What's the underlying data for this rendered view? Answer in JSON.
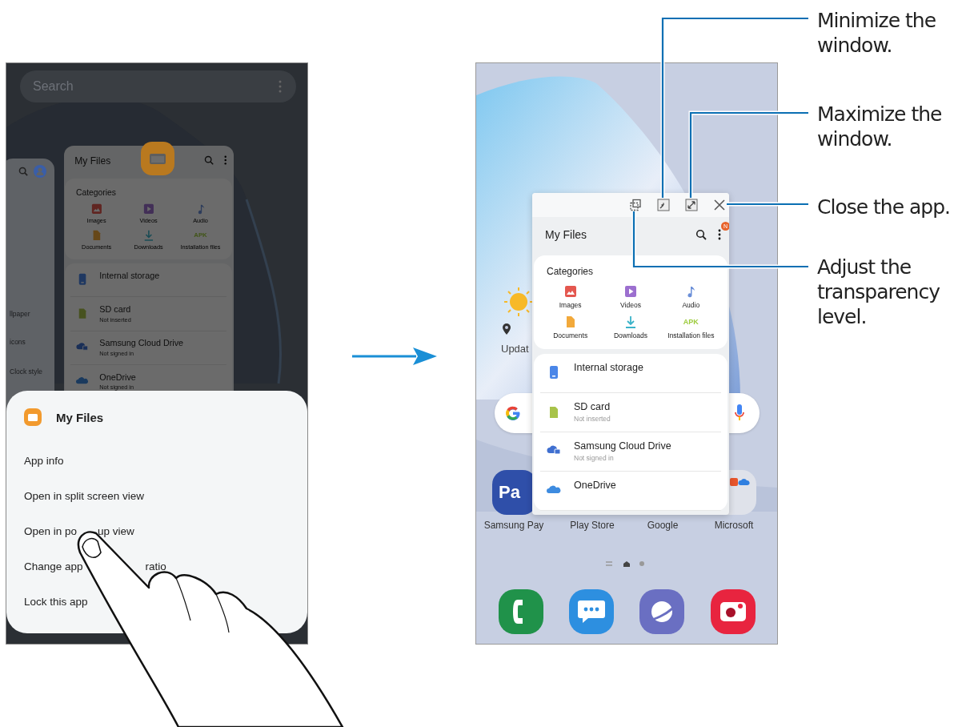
{
  "left_screen": {
    "search": {
      "placeholder": "Search"
    },
    "side_card_texts": [
      "llpaper",
      "icons",
      "Clock style"
    ],
    "recent_app": {
      "title": "My Files",
      "categories_title": "Categories",
      "categories": [
        {
          "label": "Images"
        },
        {
          "label": "Videos"
        },
        {
          "label": "Audio"
        },
        {
          "label": "Documents"
        },
        {
          "label": "Downloads"
        },
        {
          "label": "Installation files",
          "icon_text": "APK"
        }
      ],
      "storage": [
        {
          "name": "Internal storage"
        },
        {
          "name": "SD card",
          "status": "Not inserted"
        },
        {
          "name": "Samsung Cloud Drive",
          "status": "Not signed in"
        },
        {
          "name": "OneDrive",
          "status": "Not signed in"
        }
      ]
    },
    "menu": {
      "title": "My Files",
      "items": [
        [
          "App info"
        ],
        [
          "Open in split screen view"
        ],
        [
          "Open in po",
          "up view"
        ],
        [
          "Change app",
          "ratio"
        ],
        [
          "Lock this app"
        ]
      ]
    }
  },
  "right_screen": {
    "weather": {
      "text": "Updat"
    },
    "popup": {
      "title": "My Files",
      "badge": "N",
      "categories_title": "Categories",
      "categories": [
        {
          "label": "Images"
        },
        {
          "label": "Videos"
        },
        {
          "label": "Audio"
        },
        {
          "label": "Documents"
        },
        {
          "label": "Downloads"
        },
        {
          "label": "Installation files",
          "icon_text": "APK"
        }
      ],
      "storage": [
        {
          "name": "Internal storage"
        },
        {
          "name": "SD card",
          "status": "Not inserted"
        },
        {
          "name": "Samsung Cloud Drive",
          "status": "Not signed in"
        },
        {
          "name": "OneDrive"
        }
      ]
    },
    "pay_icon_text": "Pa",
    "apps": [
      "Samsung Pay",
      "Play Store",
      "Google",
      "Microsoft"
    ]
  },
  "callouts": [
    {
      "kind": "minimize",
      "text": "Minimize the window."
    },
    {
      "kind": "maximize",
      "text": "Maximize the window."
    },
    {
      "kind": "close",
      "text": "Close the app."
    },
    {
      "kind": "transparency",
      "text": "Adjust the transparency level."
    }
  ]
}
